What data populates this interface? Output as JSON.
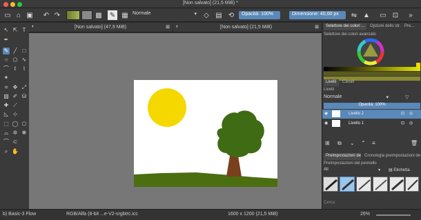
{
  "window": {
    "title": "[Non salvato]  (21,5 MiB) *"
  },
  "toolbar": {
    "blend_mode": "Normale",
    "opacity_label": "Opacità: 100%",
    "size_label": "Dimensione: 40,00 px"
  },
  "docs": [
    {
      "title": "[Non salvato]  (47,9 MiB)"
    },
    {
      "title": "[Non salvato]  (21,5 MiB)"
    }
  ],
  "colors": {
    "accent": "#5a88b8",
    "sun": "#f5d800",
    "grass": "#4a6e10",
    "tree_canopy": "#3f6b14",
    "trunk": "#7a3f1c"
  },
  "right": {
    "tabs": [
      "Selettore dei colori ...",
      "Opzioni dello str...",
      "Pre..."
    ],
    "color_section": "Selettore dei colori avanzato",
    "layer_tabs": [
      "Livelli",
      "Canali"
    ],
    "layers_title": "Livelli",
    "blend_mode": "Normale",
    "opacity": "Opacità:  100%",
    "layers": [
      {
        "name": "Livello 2",
        "selected": true
      },
      {
        "name": "Livello 1",
        "selected": false
      }
    ],
    "preset_tabs": [
      "Preimpostazioni de...",
      "Cronologia preimpostazioni de..."
    ],
    "presets_title": "Preimpostazioni del pennello",
    "preset_filter": "All",
    "preset_tag": "Etichetta",
    "search_placeholder": "Cerca"
  },
  "status": {
    "brush": "b) Basic-3 Flow",
    "colorspace": "RGB/Alfa (8-bit ...e-V2-srgbtrc.icc",
    "dimensions": "1600 x 1200 (21,5 MiB)",
    "zoom": "26%"
  }
}
